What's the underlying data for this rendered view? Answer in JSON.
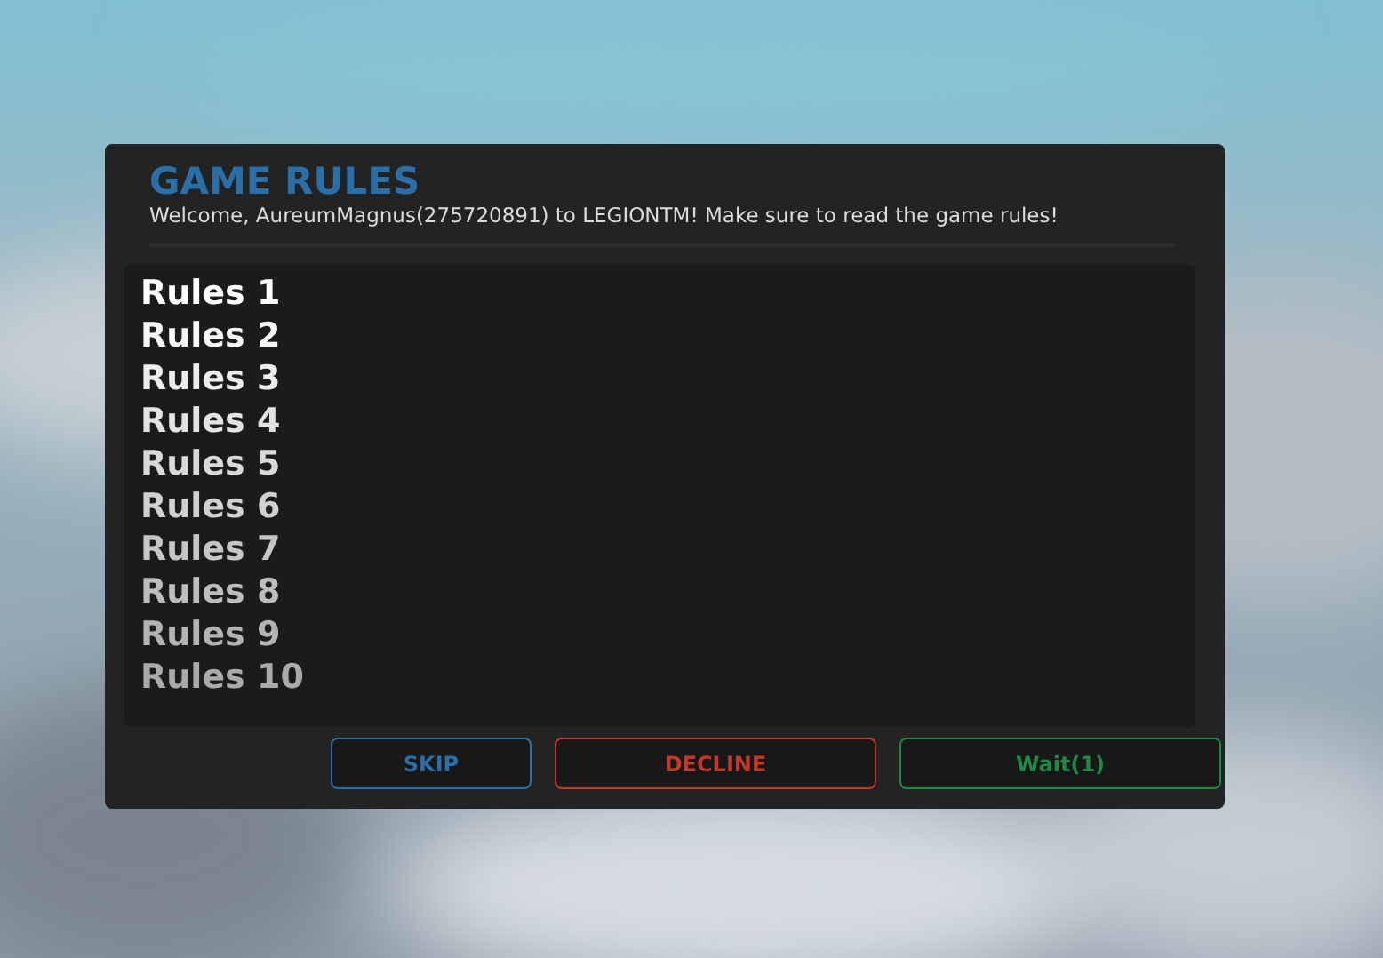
{
  "dialog": {
    "title": "GAME RULES",
    "subtitle": "Welcome, AureumMagnus(275720891) to LEGIONTM! Make sure to read the game rules!"
  },
  "rules": [
    "Rules 1",
    "Rules 2",
    "Rules 3",
    "Rules 4",
    "Rules 5",
    "Rules 6",
    "Rules 7",
    "Rules 8",
    "Rules 9",
    "Rules 10"
  ],
  "buttons": [
    {
      "label": "SKIP",
      "color": "#2a6fa8"
    },
    {
      "label": "DECLINE",
      "color": "#c0392b"
    },
    {
      "label": "Wait(1)",
      "color": "#1f8a44"
    }
  ]
}
